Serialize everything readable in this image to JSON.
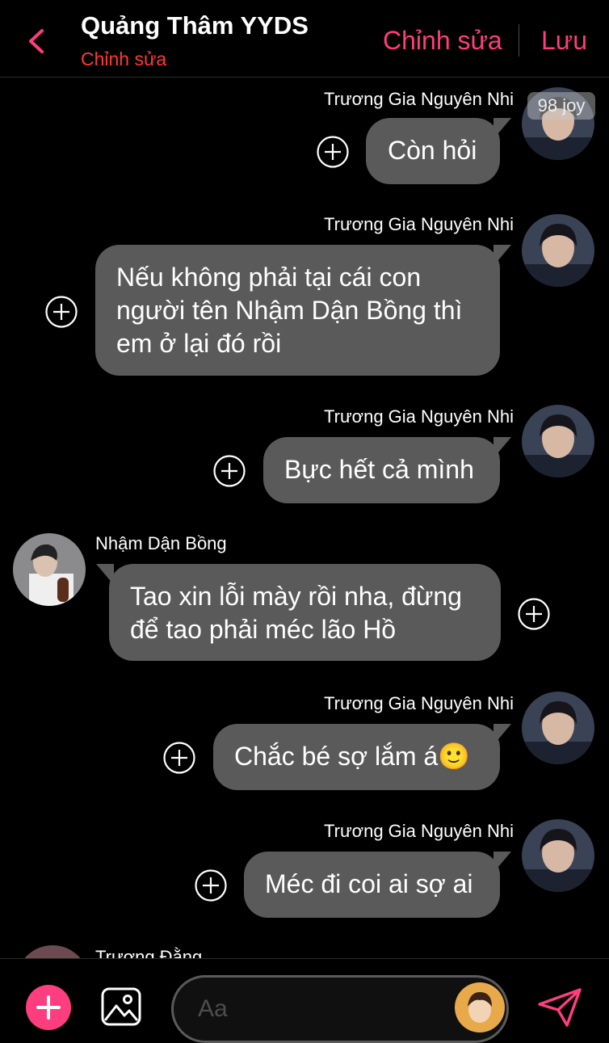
{
  "header": {
    "title": "Quảng Thâm YYDS",
    "subtitle": "Chỉnh sửa",
    "edit_label": "Chỉnh sửa",
    "save_label": "Lưu"
  },
  "watermark": "98 joy",
  "messages": [
    {
      "sender": "Trương Gia Nguyên Nhi",
      "text_lines": [
        "Còn hỏi"
      ]
    },
    {
      "sender": "Trương Gia Nguyên Nhi",
      "text_lines": [
        "Nếu không phải tại cái con",
        "người tên Nhậm Dận Bồng thì",
        "em ở lại đó rồi"
      ]
    },
    {
      "sender": "Trương Gia Nguyên Nhi",
      "text_lines": [
        "Bực hết cả mình"
      ]
    },
    {
      "sender": "Nhậm Dận Bồng",
      "text_lines": [
        "Tao xin lỗi mày rồi nha, đừng",
        "để tao phải méc lão Hồ"
      ]
    },
    {
      "sender": "Trương Gia Nguyên Nhi",
      "text_lines": [
        "Chắc bé sợ lắm á🙂"
      ]
    },
    {
      "sender": "Trương Gia Nguyên Nhi",
      "text_lines": [
        "Méc đi coi ai sợ ai"
      ]
    },
    {
      "sender": "Trương Đằng",
      "text_lines": []
    }
  ],
  "composer": {
    "placeholder": "Aa"
  },
  "colors": {
    "accent": "#ff3d7f",
    "subtitle": "#ff3b30",
    "bubble": "#5a5a5a",
    "background": "#000000"
  }
}
